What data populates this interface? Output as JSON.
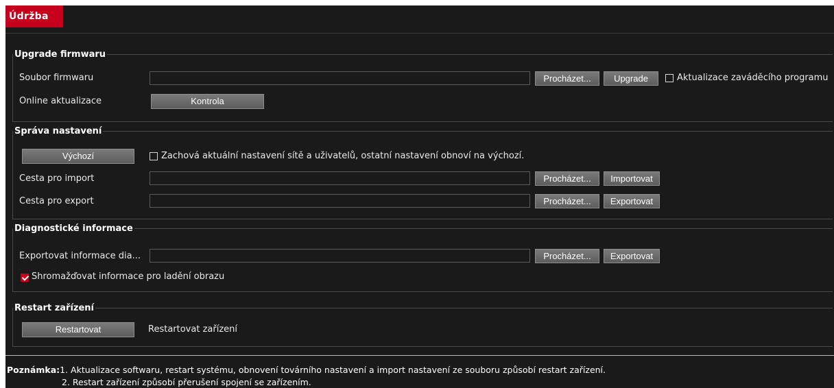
{
  "tab": {
    "label": "Údržba"
  },
  "firmware": {
    "title": "Upgrade firmwaru",
    "file_label": "Soubor firmwaru",
    "file_value": "",
    "browse": "Procházet...",
    "upgrade": "Upgrade",
    "bootloader_label": "Aktualizace zaváděcího programu",
    "bootloader_checked": false,
    "online_label": "Online aktualizace",
    "check": "Kontrola"
  },
  "settings": {
    "title": "Správa nastavení",
    "default_btn": "Výchozí",
    "keep_label": "Zachová aktuální nastavení sítě a uživatelů, ostatní nastavení obnoví na výchozí.",
    "keep_checked": false,
    "import_label": "Cesta pro import",
    "import_value": "",
    "import_browse": "Procházet...",
    "import_btn": "Importovat",
    "export_label": "Cesta pro export",
    "export_value": "",
    "export_browse": "Procházet...",
    "export_btn": "Exportovat"
  },
  "diagnostics": {
    "title": "Diagnostické informace",
    "export_label": "Exportovat informace dia...",
    "export_value": "",
    "browse": "Procházet...",
    "export_btn": "Exportovat",
    "collect_label": "Shromažďovat informace pro ladění obrazu",
    "collect_checked": true
  },
  "restart": {
    "title": "Restart zařízení",
    "btn": "Restartovat",
    "desc": "Restartovat zařízení"
  },
  "note": {
    "prefix": "Poznámka:",
    "line1": "1. Aktualizace softwaru, restart systému, obnovení továrního nastavení a import nastavení ze souboru způsobí restart zařízení.",
    "line2": "2. Restart zařízení způsobí přerušení spojení se zařízením."
  }
}
